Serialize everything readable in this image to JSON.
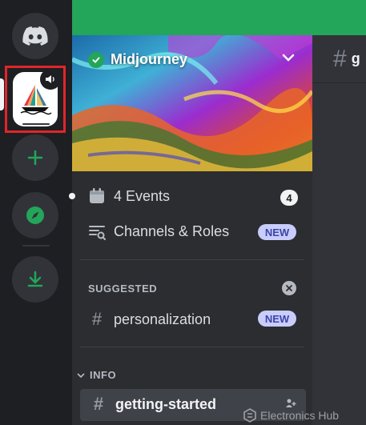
{
  "server": {
    "name": "Midjourney"
  },
  "rail": {
    "items": [
      "discord-home-icon",
      "midjourney-server-icon",
      "add-server-icon",
      "explore-icon",
      "download-icon"
    ]
  },
  "channels": {
    "events_label": "4 Events",
    "events_count": "4",
    "roles_label": "Channels & Roles",
    "new_badge": "NEW",
    "suggested_header": "SUGGESTED",
    "suggested_channel": "personalization",
    "info_header": "INFO",
    "info_channel": "getting-started"
  },
  "main": {
    "hash": "#",
    "channel_initial": "g"
  },
  "watermark": {
    "text": "Electronics Hub"
  },
  "colors": {
    "accent_green": "#23a55a",
    "highlight_red": "#e0262b",
    "new_badge_bg": "#c9cdfb",
    "new_badge_text": "#3c45a5"
  }
}
